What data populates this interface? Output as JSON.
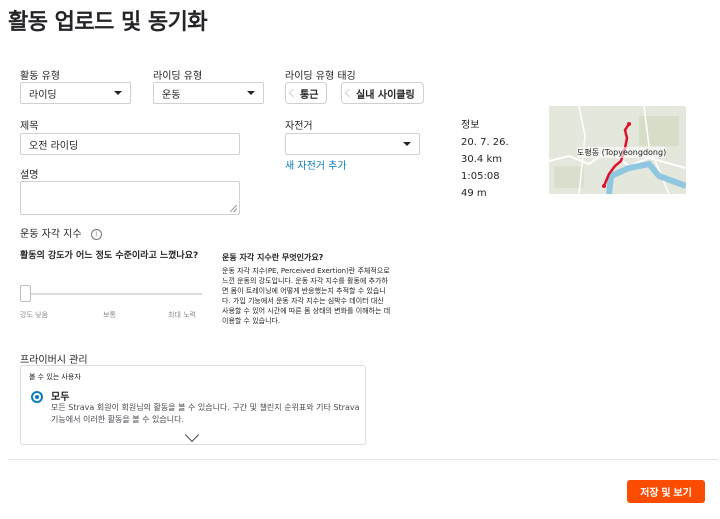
{
  "page": {
    "title": "활동 업로드 및 동기화"
  },
  "form": {
    "activity_type": {
      "label": "활동 유형",
      "value": "라이딩"
    },
    "ride_type": {
      "label": "라이딩 유형",
      "value": "운동"
    },
    "ride_tags": {
      "label": "라이딩 유형 태깅",
      "tags": [
        "통근",
        "실내 사이클링"
      ]
    },
    "title": {
      "label": "제목",
      "value": "오전 라이딩"
    },
    "bike": {
      "label": "자전거",
      "value": "",
      "add_link": "새 자전거 추가"
    },
    "description": {
      "label": "설명",
      "value": ""
    }
  },
  "info": {
    "label": "정보",
    "stats": [
      "20. 7. 26.",
      "30.4 km",
      "1:05:08",
      "49 m"
    ],
    "map_label": "도평동 (Topyeongdong)"
  },
  "rpe": {
    "label": "운동 자각 지수",
    "help_icon": "i",
    "question": "활동의 강도가 어느 정도 수준이라고 느꼈나요?",
    "slider": {
      "value": 0,
      "min_label": "강도 낮음",
      "mid_label": "보통",
      "max_label": "최대 노력"
    },
    "help_title": "운동 자각 지수란 무엇인가요?",
    "help_text": "운동 자각 지수(PE, Perceived Exertion)란 주체적으로 느낀 운동의 강도입니다. 운동 자각 지수를 활동에 추가하면 몸이 트레이닝에 어떻게 반응했는지 추적할 수 있습니다. 가입 기능에서 운동 자각 지수는 심박수 데이터 대신 사용할 수 있어 시간에 따른 몸 상태의 변화를 이해하는 데 이용할 수 있습니다."
  },
  "privacy": {
    "label": "프라이버시 관리",
    "caption": "볼 수 있는 사용자",
    "option_title": "모두",
    "option_desc": "모든 Strava 회원이 회원님의 활동을 볼 수 있습니다. 구간 및 챌린지 순위표와 기타 Strava 기능에서 이러한 활동을 볼 수 있습니다."
  },
  "actions": {
    "save_label": "저장 및 보기"
  },
  "colors": {
    "accent": "#fc4c02",
    "link": "#0b7cc1",
    "route": "#e0102a",
    "river": "#8fc7e0"
  }
}
